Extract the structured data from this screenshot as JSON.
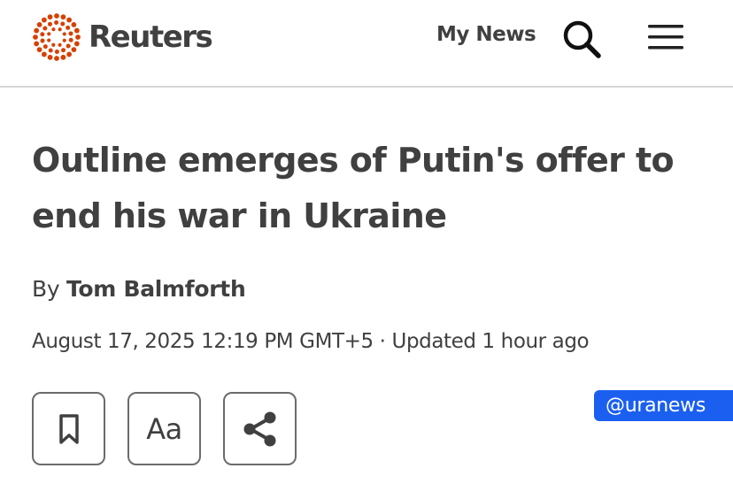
{
  "header": {
    "brand": "Reuters",
    "brand_color": "#d64000",
    "nav_my_news": "My News",
    "search_icon": "search-icon",
    "menu_icon": "hamburger-menu-icon"
  },
  "article": {
    "headline": "Outline emerges of Putin's offer to end his war in Ukraine",
    "byline_prefix": "By ",
    "author": "Tom Balmforth",
    "dateline": "August 17, 2025 12:19 PM GMT+5 · Updated 1 hour ago"
  },
  "actions": {
    "bookmark_icon": "bookmark-icon",
    "text_size_label": "Aa",
    "share_icon": "share-icon"
  },
  "watermark": {
    "text": "@uranews",
    "color": "#1a5ff0"
  }
}
